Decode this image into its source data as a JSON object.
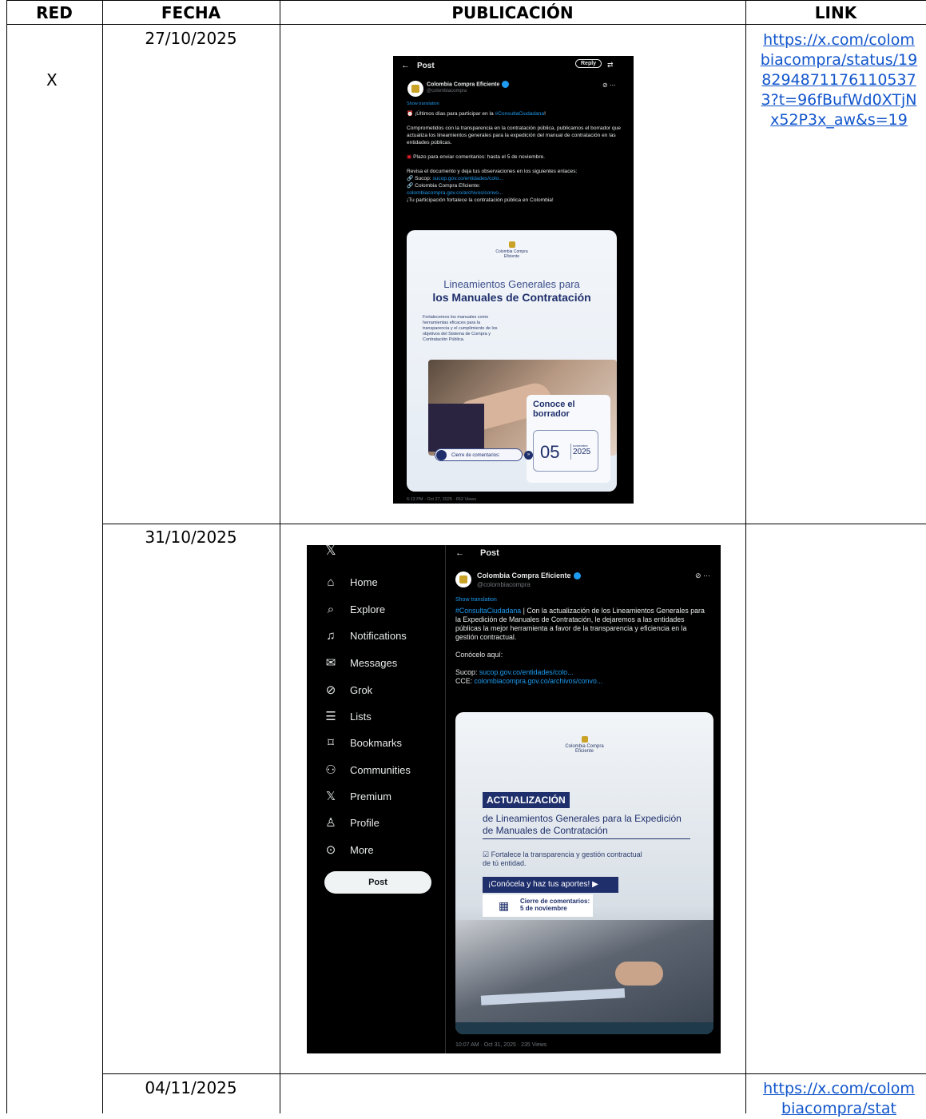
{
  "header": {
    "red": "RED",
    "fecha": "FECHA",
    "publicacion": "PUBLICACIÓN",
    "link": "LINK"
  },
  "rows": [
    {
      "red": "X",
      "fecha": "27/10/2025",
      "link": "https://x.com/colombiacompra/status/1982948711761105373?t=96fBufWd0XTjNx52P3x_aw&s=19",
      "post": {
        "title": "Post",
        "reply": "Reply",
        "account": "Colombia Compra Eficiente",
        "handle": "@colombiacompra",
        "translate": "Show translation",
        "line1": "¡Últimos días para participar en la ",
        "hashtag": "#ConsultaCiudadana",
        "line1_end": "!",
        "body": "Comprometidos con la transparencia en la contratación pública, publicamos el borrador que actualiza los lineamientos generales para la expedición del manual de contratación en las entidades públicas.",
        "plazo": "Plazo para enviar comentarios: hasta el 5 de noviembre.",
        "revisa": "Revisa el documento y deja tus observaciones en los siguientes enlaces:",
        "sucop_label": "Sucop: ",
        "sucop_link": "sucop.gov.co/entidades/colo...",
        "cce_label": "Colombia Compra Eficiente:",
        "cce_link": "colombiacompra.gov.co/archivos/convo...",
        "closing": "¡Tu participación fortalece la contratación pública en Colombia!",
        "meta": "6:13 PM · Oct 27, 2025 · 652 Views",
        "card": {
          "logo": "Colombia Compra Eficiente",
          "title1": "Lineamientos Generales para",
          "title2": "los Manuales de Contratación",
          "desc": "Fortalecemos los manuales como herramientas eficaces para la transparencia y el cumplimiento de los objetivos del Sistema de Compra y Contratación Pública.",
          "cta": "Conoce el borrador",
          "cierre": "Cierre de comentarios:",
          "day": "05",
          "month": "noviembre",
          "year": "2025"
        }
      }
    },
    {
      "fecha": "31/10/2025",
      "link": "",
      "post": {
        "nav": [
          {
            "label": "Home",
            "icon": "home-icon",
            "glyph": "⌂"
          },
          {
            "label": "Explore",
            "icon": "search-icon",
            "glyph": "⌕"
          },
          {
            "label": "Notifications",
            "icon": "bell-icon",
            "glyph": "♫"
          },
          {
            "label": "Messages",
            "icon": "mail-icon",
            "glyph": "✉"
          },
          {
            "label": "Grok",
            "icon": "grok-icon",
            "glyph": "⊘"
          },
          {
            "label": "Lists",
            "icon": "list-icon",
            "glyph": "☰"
          },
          {
            "label": "Bookmarks",
            "icon": "bookmark-icon",
            "glyph": "⌑"
          },
          {
            "label": "Communities",
            "icon": "communities-icon",
            "glyph": "⚇"
          },
          {
            "label": "Premium",
            "icon": "x-logo-icon",
            "glyph": "𝕏"
          },
          {
            "label": "Profile",
            "icon": "profile-icon",
            "glyph": "♙"
          },
          {
            "label": "More",
            "icon": "more-icon",
            "glyph": "⊙"
          }
        ],
        "post_button": "Post",
        "title": "Post",
        "account": "Colombia Compra Eficiente",
        "handle": "@colombiacompra",
        "translate": "Show translation",
        "hashtag": "#ConsultaCiudadana",
        "body": " | Con la actualización de los Lineamientos Generales para la Expedición de Manuales de Contratación, le dejaremos a las entidades públicas la mejor herramienta a favor de la transparencia y eficiencia en la gestión contractual.",
        "conocelo": "Conócelo aquí:",
        "sucop_label": "Sucop: ",
        "sucop_link": "sucop.gov.co/entidades/colo...",
        "cce_label": "CCE: ",
        "cce_link": "colombiacompra.gov.co/archivos/convo...",
        "meta": "10:07 AM · Oct 31, 2025 · 235 Views",
        "card": {
          "logo": "Colombia Compra Eficiente",
          "badge": "ACTUALIZACIÓN",
          "title": "de Lineamientos Generales para la Expedición de Manuales de Contratación",
          "check": "Fortalece la transparencia y gestión contractual de tú entidad.",
          "cta": "¡Conócela y haz tus aportes!",
          "cierre": "Cierre de comentarios:",
          "cierre_date": "5 de noviembre"
        }
      }
    },
    {
      "fecha": "04/11/2025",
      "link": "https://x.com/colombiacompra/stat"
    }
  ]
}
